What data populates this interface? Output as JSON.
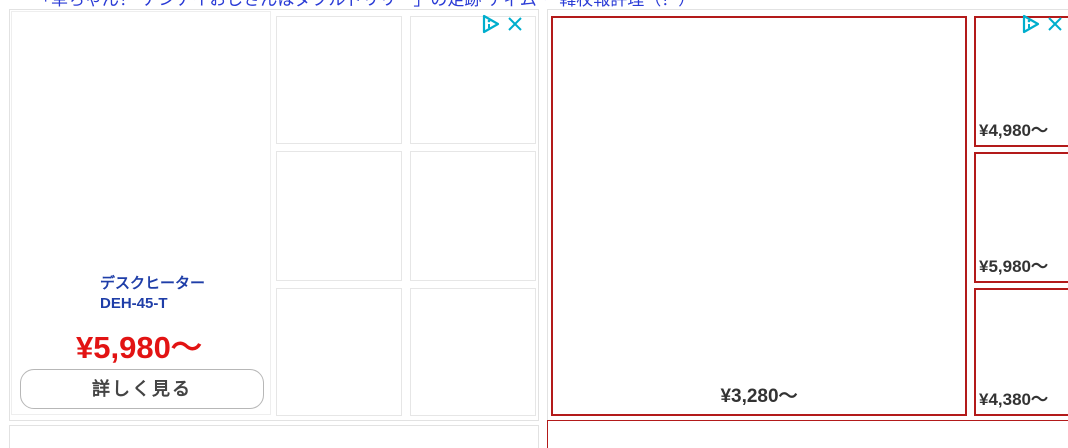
{
  "article": {
    "headline_cut": "「草ちゃん！ ナンナイおじさんはダブルドリリー」の足跡 ティム・ 韓杖報評理（？）"
  },
  "ad_left": {
    "badge_icons": [
      "adchoices-icon",
      "close-icon"
    ],
    "product": {
      "name_line1": "デスクヒーター",
      "name_line2": "DEH-45-T",
      "price": "¥5,980〜",
      "cta": "詳しく見る"
    }
  },
  "ad_right": {
    "badge_icons": [
      "adchoices-icon",
      "close-icon"
    ],
    "main_price": "¥3,280〜",
    "side_prices": [
      "¥4,980〜",
      "¥5,980〜",
      "¥4,380〜"
    ]
  },
  "colors": {
    "price_red": "#e21313",
    "name_blue": "#1f3ea8",
    "ad_border_red": "#b31a1a",
    "adchoices_cyan": "#00aecd",
    "link_blue": "#2a3bd6"
  }
}
